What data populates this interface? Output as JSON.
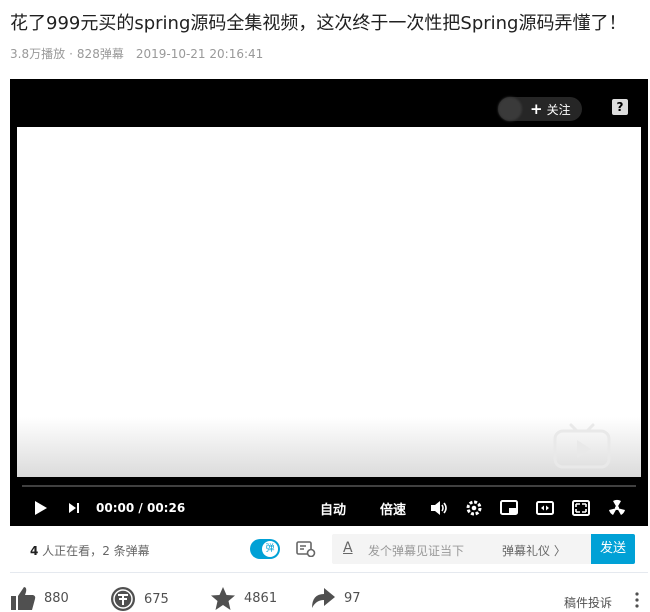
{
  "video": {
    "title": "花了999元买的spring源码全集视频，这次终于一次性把Spring源码弄懂了！",
    "plays": "3.8万播放",
    "separator": "·",
    "danmaku_count": "828弹幕",
    "date": "2019-10-21 20:16:41"
  },
  "player": {
    "follow_label": "关注",
    "follow_plus": "+",
    "help_label": "?",
    "time_current": "00:00",
    "time_separator": "/",
    "time_total": "00:26",
    "auto_quality_label": "自动",
    "speed_label": "倍速",
    "progress": 0
  },
  "danmaku_bar": {
    "viewers_count": "4",
    "viewers_text": " 人正在看，",
    "danmaku_count": "2",
    "danmaku_text": " 条弹幕",
    "toggle_label": "弹",
    "style_label": "A",
    "input_placeholder": "发个弹幕见证当下",
    "etiquette_label": "弹幕礼仪 〉",
    "send_label": "发送"
  },
  "actions": {
    "like_count": "880",
    "coin_count": "675",
    "favorite_count": "4861",
    "share_count": "97",
    "report_label": "稿件投诉"
  },
  "icons": {
    "like": "thumbs-up-icon",
    "coin": "coin-icon",
    "favorite": "star-icon",
    "share": "share-arrow-icon",
    "more": "more-vertical-icon"
  },
  "colors": {
    "accent": "#00a1d6",
    "icon_gray": "#505050"
  }
}
